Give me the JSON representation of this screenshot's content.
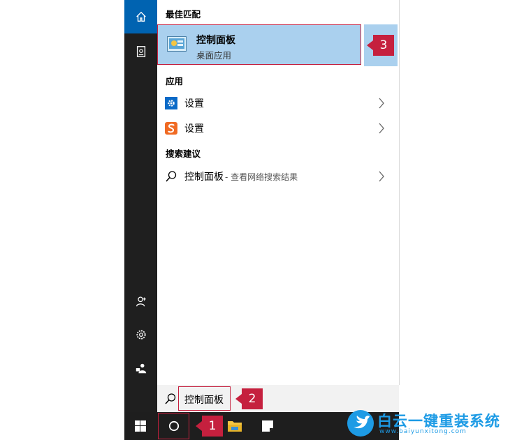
{
  "sidebar": {
    "items": [
      {
        "icon": "home-icon"
      },
      {
        "icon": "notebook-icon"
      },
      {
        "icon": "account-icon"
      },
      {
        "icon": "settings-gear-icon"
      },
      {
        "icon": "feedback-icon"
      }
    ]
  },
  "results": {
    "best_match_heading": "最佳匹配",
    "best_match": {
      "title": "控制面板",
      "subtitle": "桌面应用",
      "icon": "control-panel-icon"
    },
    "apps_heading": "应用",
    "apps": [
      {
        "label": "设置",
        "icon": "settings-blue-icon"
      },
      {
        "label": "设置",
        "icon": "sogou-settings-icon"
      }
    ],
    "suggest_heading": "搜索建议",
    "suggestions": [
      {
        "label": "控制面板",
        "suffix": " - 查看网络搜索结果"
      }
    ]
  },
  "search": {
    "value": "控制面板"
  },
  "badges": {
    "b1": "1",
    "b2": "2",
    "b3": "3"
  },
  "watermark": {
    "title": "白云一键重装系统",
    "url": "www.baiyunxitong.com"
  },
  "colors": {
    "accent": "#0063b1",
    "highlight": "#aad0ee",
    "badge": "#c5203e",
    "rail": "#1f1f1f"
  }
}
